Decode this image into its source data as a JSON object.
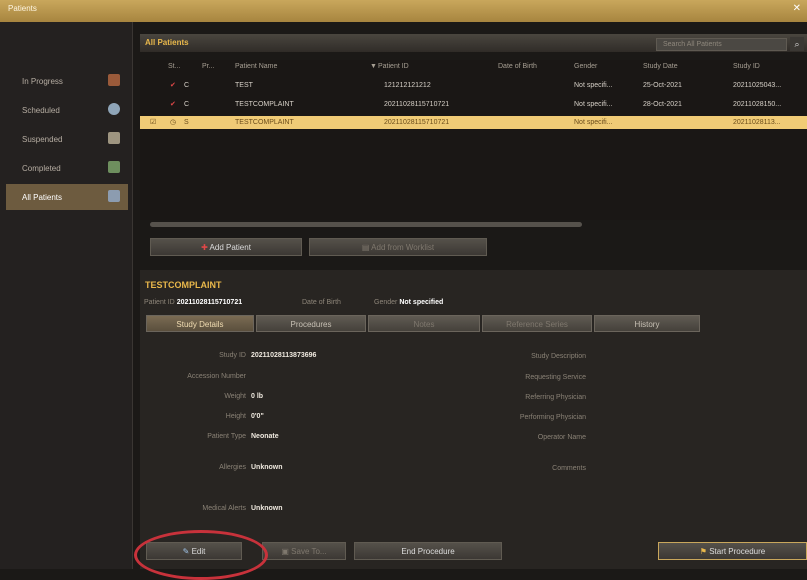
{
  "window": {
    "title": "Patients",
    "close": "✕"
  },
  "sidebar": {
    "items": [
      {
        "label": "In Progress"
      },
      {
        "label": "Scheduled"
      },
      {
        "label": "Suspended"
      },
      {
        "label": "Completed"
      },
      {
        "label": "All Patients"
      }
    ]
  },
  "list": {
    "title": "All Patients",
    "search_placeholder": "Search All Patients",
    "columns": [
      "St...",
      "Pr...",
      "Patient Name",
      "Patient ID",
      "Date of Birth",
      "Gender",
      "Study Date",
      "Study ID"
    ],
    "rows": [
      {
        "status": "C",
        "name": "TEST",
        "id": "121212121212",
        "dob": "",
        "gender": "Not specifi...",
        "date": "25-Oct-2021",
        "study": "20211025043..."
      },
      {
        "status": "C",
        "name": "TESTCOMPLAINT",
        "id": "20211028115710721",
        "dob": "",
        "gender": "Not specifi...",
        "date": "28-Oct-2021",
        "study": "20211028150..."
      },
      {
        "status": "S",
        "name": "TESTCOMPLAINT",
        "id": "20211028115710721",
        "dob": "",
        "gender": "Not specifi...",
        "date": "",
        "study": "20211028113..."
      }
    ],
    "add_patient": "Add Patient",
    "add_worklist": "Add from Worklist"
  },
  "detail": {
    "patient_name": "TESTCOMPLAINT",
    "patient_id_label": "Patient ID",
    "patient_id": "20211028115710721",
    "dob_label": "Date of Birth",
    "gender_label": "Gender",
    "gender": "Not specified",
    "tabs": [
      "Study Details",
      "Procedures",
      "Notes",
      "Reference Series",
      "History"
    ],
    "fields": {
      "study_id_label": "Study ID",
      "study_id": "20211028113873696",
      "accession_label": "Accession Number",
      "weight_label": "Weight",
      "weight": "0 lb",
      "height_label": "Height",
      "height": "0'0\"",
      "patient_type_label": "Patient Type",
      "patient_type": "Neonate",
      "allergies_label": "Allergies",
      "allergies": "Unknown",
      "medical_alerts_label": "Medical Alerts",
      "medical_alerts": "Unknown",
      "study_desc_label": "Study Description",
      "req_service_label": "Requesting Service",
      "ref_phys_label": "Referring Physician",
      "perf_phys_label": "Performing Physician",
      "operator_label": "Operator Name",
      "comments_label": "Comments"
    }
  },
  "footer": {
    "edit": "Edit",
    "save": "Save To...",
    "end": "End Procedure",
    "start": "Start Procedure"
  },
  "colors": {
    "accent": "#e9b84b",
    "selection": "#f0cb76",
    "highlight_circle": "#c8323b"
  }
}
